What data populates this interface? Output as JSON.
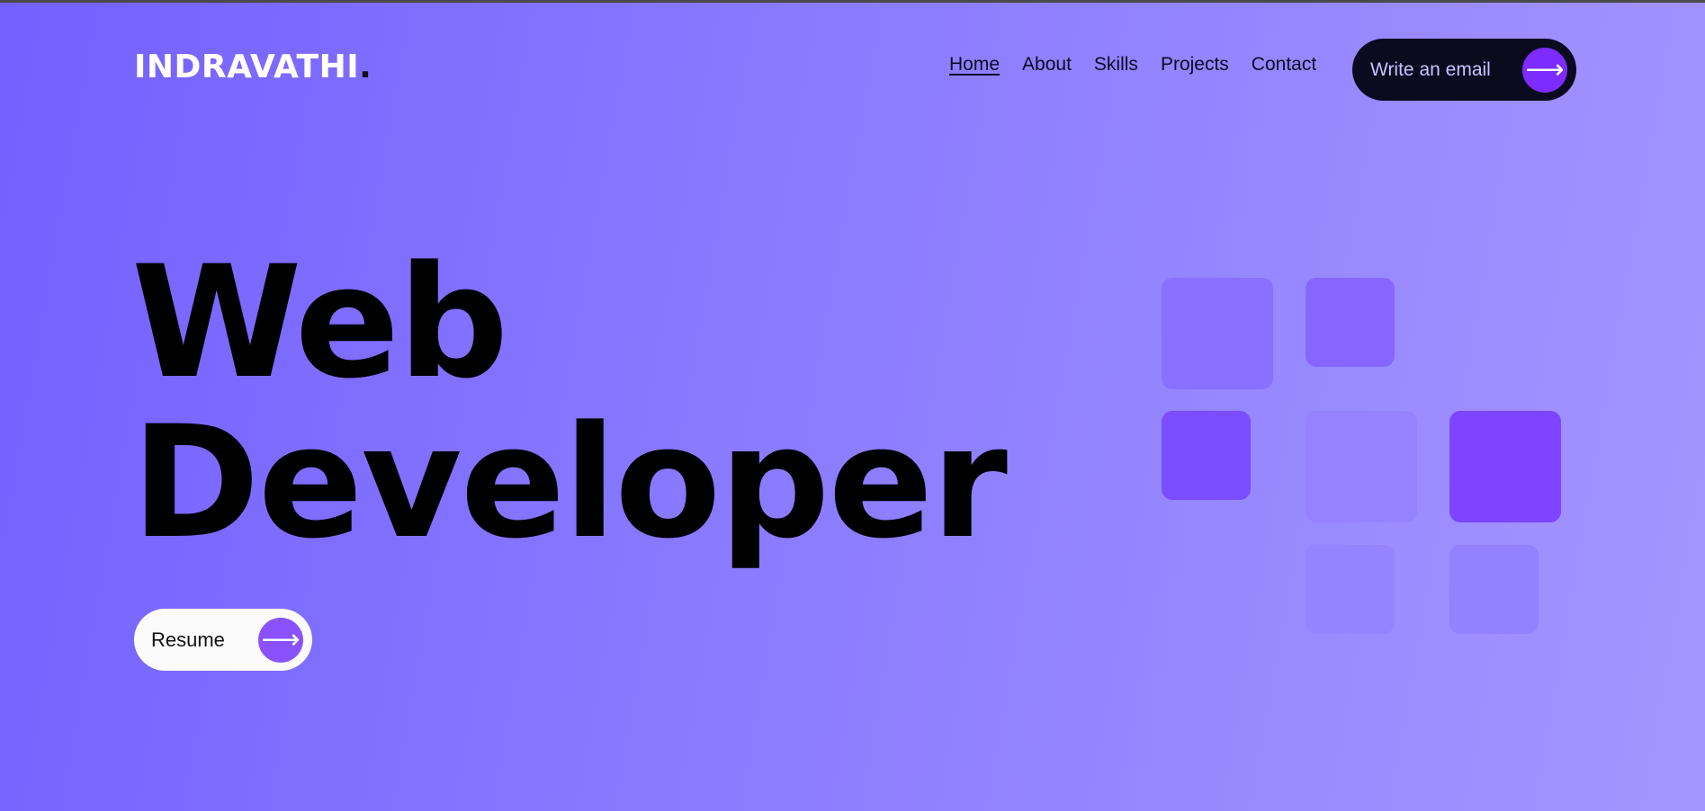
{
  "header": {
    "logo_text": "INDRAVATHI",
    "logo_dot": ".",
    "nav": [
      {
        "label": "Home"
      },
      {
        "label": "About"
      },
      {
        "label": "Skills"
      },
      {
        "label": "Projects"
      },
      {
        "label": "Contact"
      }
    ],
    "email_button_label": "Write an email",
    "arrow_glyph": "⟶"
  },
  "hero": {
    "title_line1": "Web",
    "title_line2": "Developer",
    "resume_label": "Resume"
  },
  "colors": {
    "background_start": "#7460ff",
    "background_end": "#a595ff",
    "accent": "#7c2cff",
    "email_button_bg": "#0b0a1f",
    "resume_button_bg": "#fbfbfb"
  },
  "decor": {
    "squares": [
      {
        "name": "decor-square-1",
        "color": "#8a70ff"
      },
      {
        "name": "decor-square-2",
        "color": "#8766ff"
      },
      {
        "name": "decor-square-3",
        "color": "#7a4dff"
      },
      {
        "name": "decor-square-4",
        "color": "#9682ff"
      },
      {
        "name": "decor-square-5",
        "color": "#7d45ff"
      },
      {
        "name": "decor-square-6",
        "color": "#9583ff"
      },
      {
        "name": "decor-square-7",
        "color": "#9481ff"
      }
    ]
  }
}
